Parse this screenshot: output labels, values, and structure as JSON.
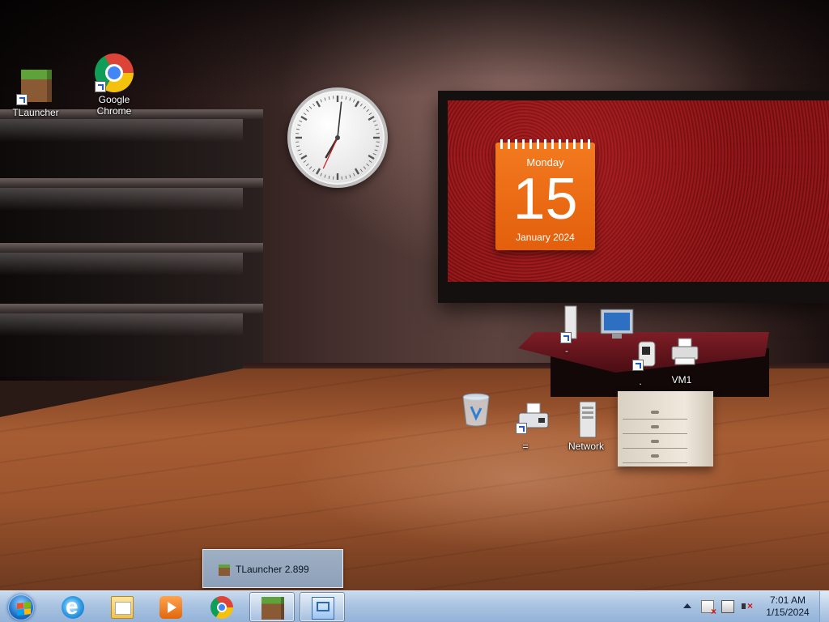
{
  "desktop_icons": {
    "tlauncher": {
      "label": "TLauncher"
    },
    "chrome": {
      "label": "Google\nChrome"
    },
    "computer_shortcut": {
      "label": "-"
    },
    "printer_shortcut": {
      "label": "."
    },
    "vm1": {
      "label": "VM1"
    },
    "recycle_bin": {
      "label": ""
    },
    "fax_shortcut": {
      "label": "="
    },
    "network": {
      "label": "Network"
    }
  },
  "gadgets": {
    "calendar": {
      "weekday": "Monday",
      "day": "15",
      "month_year": "January 2024"
    },
    "clock": {
      "hour": 7,
      "minute": 1
    }
  },
  "taskbar": {
    "pinned": [
      {
        "name": "internet-explorer-icon"
      },
      {
        "name": "file-explorer-icon"
      },
      {
        "name": "media-player-icon"
      },
      {
        "name": "google-chrome-icon"
      },
      {
        "name": "tlauncher-icon"
      },
      {
        "name": "remote-desktop-icon"
      }
    ],
    "preview": {
      "title": "TLauncher 2.899"
    },
    "tray": {
      "time": "7:01 AM",
      "date": "1/15/2024"
    }
  },
  "colors": {
    "taskbar": "#a9c3e1",
    "calendar": "#f37a1f",
    "frame_red": "#7b1214"
  }
}
